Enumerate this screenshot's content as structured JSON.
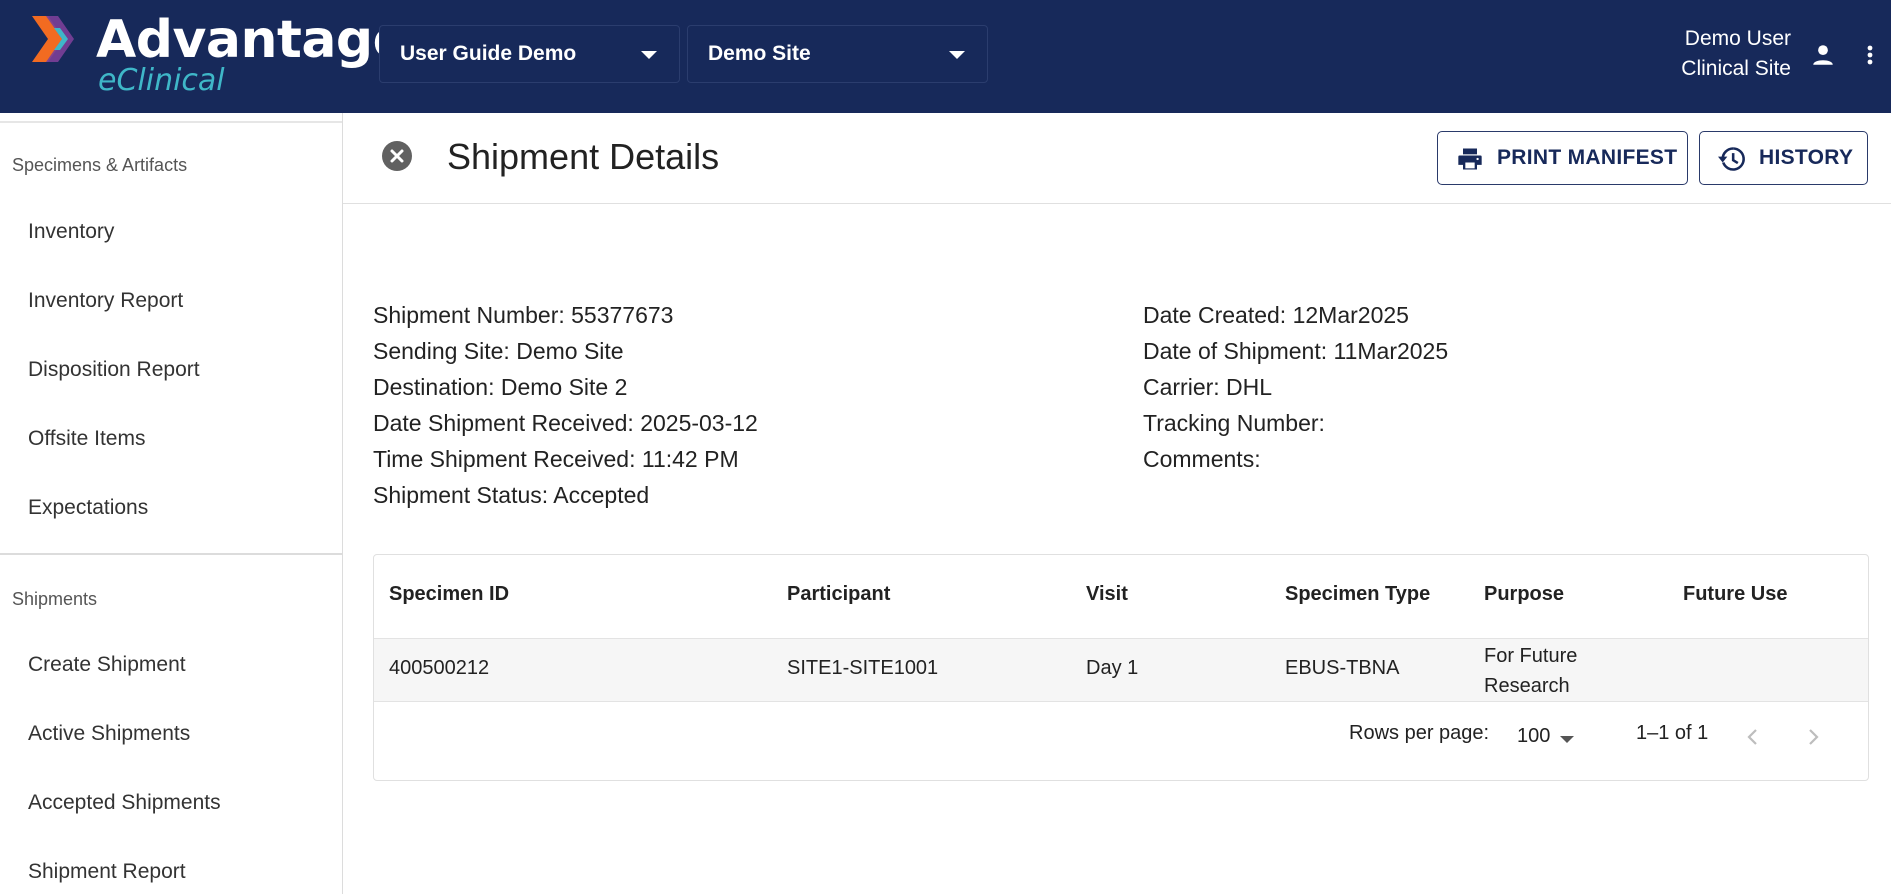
{
  "brand": {
    "name": "Advantage",
    "sub": "eClinical"
  },
  "header": {
    "study_select": "User Guide Demo",
    "site_select": "Demo Site",
    "user_name": "Demo User",
    "user_role": "Clinical Site"
  },
  "sidebar": {
    "section1": "Specimens & Artifacts",
    "items1": [
      "Inventory",
      "Inventory Report",
      "Disposition Report",
      "Offsite Items",
      "Expectations"
    ],
    "section2": "Shipments",
    "items2": [
      "Create Shipment",
      "Active Shipments",
      "Accepted Shipments",
      "Shipment Report"
    ]
  },
  "page": {
    "title": "Shipment Details",
    "print_label": "PRINT MANIFEST",
    "history_label": "HISTORY"
  },
  "details_left": [
    "Shipment Number: 55377673",
    "Sending Site: Demo Site",
    "Destination: Demo Site 2",
    "Date Shipment Received: 2025-03-12",
    "Time Shipment Received: 11:42 PM",
    "Shipment Status: Accepted"
  ],
  "details_right": [
    "Date Created: 12Mar2025",
    "Date of Shipment: 11Mar2025",
    "Carrier: DHL",
    "Tracking Number:",
    "Comments:"
  ],
  "table": {
    "columns": [
      "Specimen ID",
      "Participant",
      "Visit",
      "Specimen Type",
      "Purpose",
      "Future Use"
    ],
    "rows": [
      {
        "specimen_id": "400500212",
        "participant": "SITE1-SITE1001",
        "visit": "Day 1",
        "type": "EBUS-TBNA",
        "purpose_line1": "For Future",
        "purpose_line2": "Research",
        "future_use": ""
      }
    ],
    "rows_per_page_label": "Rows per page:",
    "rows_per_page": "100",
    "range": "1–1 of 1"
  },
  "colors": {
    "topbar": "#17295a",
    "accent_teal": "#3fb7c8",
    "logo_orange": "#f26b21",
    "logo_purple": "#7b3f98"
  }
}
